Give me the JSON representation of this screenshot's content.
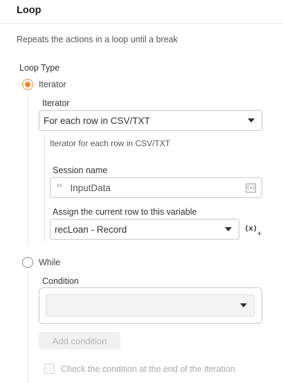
{
  "header": {
    "title": "Loop"
  },
  "description": "Repeats the actions in a loop until a break",
  "loop_type": {
    "label": "Loop Type",
    "options": [
      {
        "label": "Iterator",
        "selected": true
      },
      {
        "label": "While",
        "selected": false
      }
    ]
  },
  "iterator": {
    "label": "Iterator",
    "selected": "For each row in CSV/TXT",
    "hint": "Iterator for each row in CSV/TXT",
    "session_name": {
      "label": "Session name",
      "value": "InputData",
      "var_icon_text": "{x}"
    },
    "assign": {
      "label": "Assign the current row to this variable",
      "selected": "recLoan - Record",
      "fx_icon_text": "(x)",
      "fx_plus": "+"
    }
  },
  "while": {
    "condition_label": "Condition",
    "condition_selected": "",
    "add_condition_label": "Add condition",
    "check_end_label": "Check the condition at the end of the iteration",
    "check_end_checked": false
  },
  "colors": {
    "accent": "#f08a24",
    "border": "#c8c8c8",
    "disabled_text": "#aaaaaa"
  },
  "icons": [
    "radio-checked",
    "radio-unchecked",
    "chevron-down-icon",
    "quote-icon",
    "variable-icon",
    "insert-variable-icon",
    "checkbox-icon"
  ]
}
